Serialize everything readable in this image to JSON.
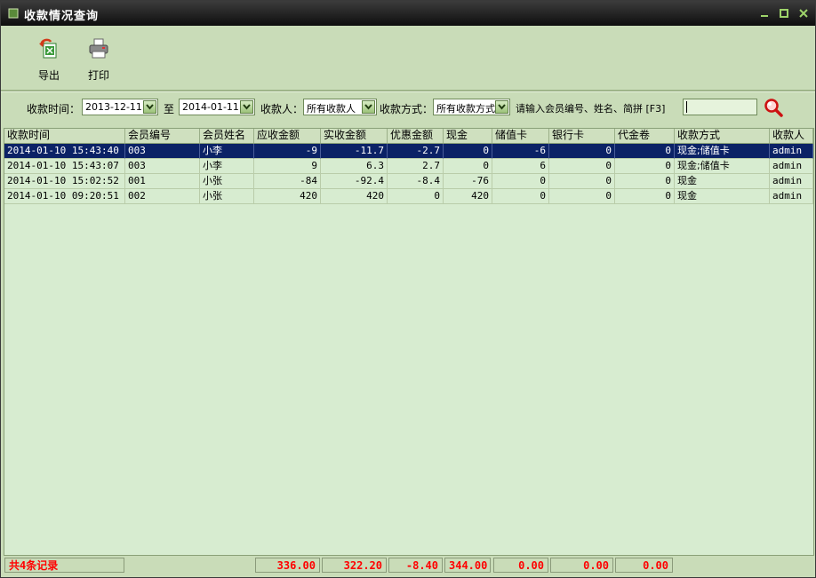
{
  "window": {
    "title": "收款情况查询"
  },
  "toolbar": {
    "export_label": "导出",
    "print_label": "打印"
  },
  "filter": {
    "time_label": "收款时间：",
    "date_from": "2013-12-11",
    "to_label": "至",
    "date_to": "2014-01-11",
    "payee_label": "收款人：",
    "payee_value": "所有收款人",
    "method_label": "收款方式：",
    "method_value": "所有收款方式",
    "search_hint": "请输入会员编号、姓名、简拼 [F3]",
    "search_value": ""
  },
  "table": {
    "columns": [
      "收款时间",
      "会员编号",
      "会员姓名",
      "应收金额",
      "实收金额",
      "优惠金额",
      "现金",
      "储值卡",
      "银行卡",
      "代金卷",
      "收款方式",
      "收款人"
    ],
    "rows": [
      [
        "2014-01-10 15:43:40",
        "003",
        "小李",
        "-9",
        "-11.7",
        "-2.7",
        "0",
        "-6",
        "0",
        "0",
        "现金;储值卡",
        "admin"
      ],
      [
        "2014-01-10 15:43:07",
        "003",
        "小李",
        "9",
        "6.3",
        "2.7",
        "0",
        "6",
        "0",
        "0",
        "现金;储值卡",
        "admin"
      ],
      [
        "2014-01-10 15:02:52",
        "001",
        "小张",
        "-84",
        "-92.4",
        "-8.4",
        "-76",
        "0",
        "0",
        "0",
        "现金",
        "admin"
      ],
      [
        "2014-01-10 09:20:51",
        "002",
        "小张",
        "420",
        "420",
        "0",
        "420",
        "0",
        "0",
        "0",
        "现金",
        "admin"
      ]
    ],
    "selected_row": 0
  },
  "footer": {
    "count": "共4条记录",
    "totals": [
      "336.00",
      "322.20",
      "-8.40",
      "344.00",
      "0.00",
      "0.00",
      "0.00"
    ]
  },
  "colors": {
    "accent": "#0b2266",
    "background": "#c9dcb8",
    "grid": "#d7ecd0",
    "total_text": "#ff0000"
  }
}
